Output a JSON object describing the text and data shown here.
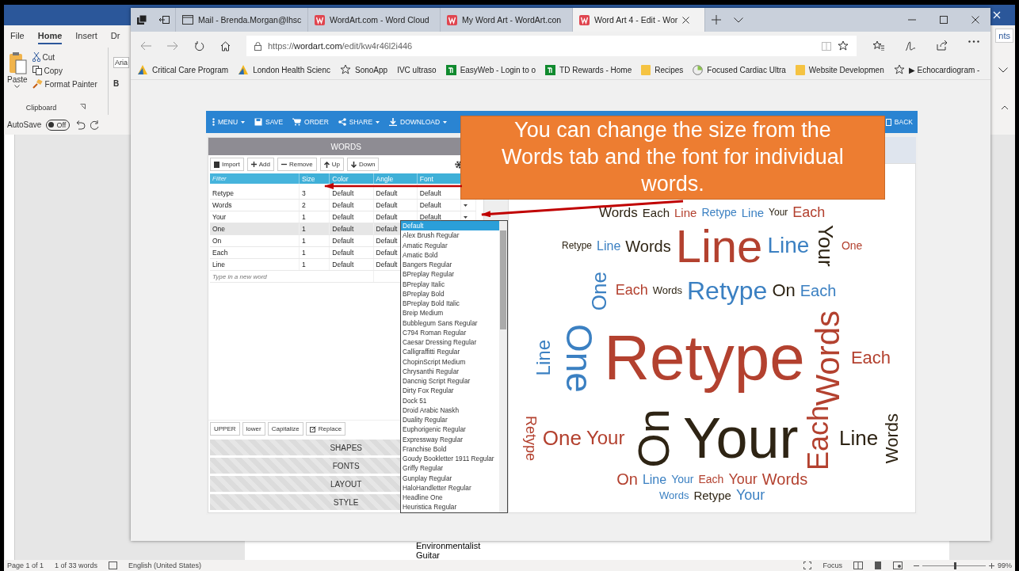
{
  "word": {
    "ribbon_tabs": [
      {
        "label": "File",
        "selected": false
      },
      {
        "label": "Home",
        "selected": true
      },
      {
        "label": "Insert",
        "selected": false
      },
      {
        "label": "Dr",
        "selected": false
      }
    ],
    "clipboard": {
      "paste": "Paste",
      "cut": "Cut",
      "copy": "Copy",
      "format_painter": "Format Painter",
      "group_label": "Clipboard"
    },
    "font_box": "Aria",
    "bold": "B",
    "comments": "nts",
    "autosave": {
      "label": "AutoSave",
      "value": "Off",
      "on": false
    },
    "document_lines": [
      "Environmentalist",
      "Guitar"
    ],
    "status_bar": {
      "page": "Page 1 of 1",
      "words": "1 of 33 words",
      "language": "English (United States)",
      "focus": "Focus",
      "zoom": "99%",
      "level": 0.5
    }
  },
  "browser": {
    "tabs": [
      {
        "title": "Mail - Brenda.Morgan@lhsc",
        "kind": "mail",
        "selected": false
      },
      {
        "title": "WordArt.com - Word Cloud",
        "kind": "wordart",
        "selected": false
      },
      {
        "title": "My Word Art - WordArt.con",
        "kind": "wordart",
        "selected": false
      },
      {
        "title": "Word Art 4 - Edit - Wor",
        "kind": "wordart",
        "selected": true
      }
    ],
    "url": {
      "scheme": "https://",
      "host": "wordart.com",
      "path": "/edit/kw4r46l2i446"
    },
    "favorites": [
      {
        "label": "Critical Care Program",
        "kind": "logo"
      },
      {
        "label": "London Health Scienc",
        "kind": "logo"
      },
      {
        "label": "SonoApp",
        "kind": "star"
      },
      {
        "label": "IVC ultraso",
        "kind": "none"
      },
      {
        "label": "EasyWeb - Login to o",
        "kind": "td"
      },
      {
        "label": "TD Rewards - Home",
        "kind": "td"
      },
      {
        "label": "Recipes",
        "kind": "folder"
      },
      {
        "label": "Focused Cardiac Ultra",
        "kind": "globe"
      },
      {
        "label": "Website Developmen",
        "kind": "folder"
      },
      {
        "label": "▶ Echocardiogram -",
        "kind": "star"
      }
    ]
  },
  "wordart": {
    "toolbar": [
      {
        "label": "MENU",
        "kind": "menu",
        "caret": true
      },
      {
        "label": "SAVE",
        "kind": "save",
        "caret": false
      },
      {
        "label": "ORDER",
        "kind": "cart",
        "caret": false
      },
      {
        "label": "SHARE",
        "kind": "share",
        "caret": true
      },
      {
        "label": "DOWNLOAD",
        "kind": "download",
        "caret": true
      }
    ],
    "back": "BACK",
    "panel_title": "WORDS",
    "word_buttons": [
      {
        "label": "Import",
        "kind": "import"
      },
      {
        "label": "Add",
        "kind": "add"
      },
      {
        "label": "Remove",
        "kind": "remove"
      },
      {
        "label": "Up",
        "kind": "up"
      },
      {
        "label": "Down",
        "kind": "down"
      }
    ],
    "filter_placeholder": "Filter",
    "columns": [
      "Size",
      "Color",
      "Angle",
      "Font"
    ],
    "rows": [
      {
        "word": "Retype",
        "size": "3",
        "color_value": "Default",
        "angle": "Default",
        "font": "Default",
        "selected": false
      },
      {
        "word": "Words",
        "size": "2",
        "color_value": "Default",
        "angle": "Default",
        "font": "Default",
        "selected": false
      },
      {
        "word": "Your",
        "size": "1",
        "color_value": "Default",
        "angle": "Default",
        "font": "Default",
        "selected": false
      },
      {
        "word": "One",
        "size": "1",
        "color_value": "Default",
        "angle": "Default",
        "selected": true
      },
      {
        "word": "On",
        "size": "1",
        "color_value": "Default",
        "angle": "Default",
        "selected": false
      },
      {
        "word": "Each",
        "size": "1",
        "color_value": "Default",
        "angle": "Default",
        "selected": false
      },
      {
        "word": "Line",
        "size": "1",
        "color_value": "Default",
        "angle": "Default",
        "selected": false
      }
    ],
    "new_word_placeholder": "Type in a new word",
    "case_buttons": [
      {
        "label": "UPPER",
        "kind": "text"
      },
      {
        "label": "lower",
        "kind": "text"
      },
      {
        "label": "Capitalize",
        "kind": "text"
      },
      {
        "label": "Replace",
        "kind": "edit"
      }
    ],
    "sections": [
      "SHAPES",
      "FONTS",
      "LAYOUT",
      "STYLE"
    ],
    "font_list": [
      {
        "label": "Default",
        "selected": true
      },
      {
        "label": "Alex Brush Regular",
        "selected": false
      },
      {
        "label": "Amatic Regular",
        "selected": false
      },
      {
        "label": "Amatic Bold",
        "selected": false
      },
      {
        "label": "Bangers Regular",
        "selected": false
      },
      {
        "label": "BPreplay Regular",
        "selected": false
      },
      {
        "label": "BPreplay Italic",
        "selected": false
      },
      {
        "label": "BPreplay Bold",
        "selected": false
      },
      {
        "label": "BPreplay Bold Italic",
        "selected": false
      },
      {
        "label": "Breip Medium",
        "selected": false
      },
      {
        "label": "Bubblegum Sans Regular",
        "selected": false
      },
      {
        "label": "C794 Roman Regular",
        "selected": false
      },
      {
        "label": "Caesar Dressing Regular",
        "selected": false
      },
      {
        "label": "Calligraffitti Regular",
        "selected": false
      },
      {
        "label": "ChopinScript Medium",
        "selected": false
      },
      {
        "label": "Chrysanthi Regular",
        "selected": false
      },
      {
        "label": "Dancnig Script Regular",
        "selected": false
      },
      {
        "label": "Dirty Fox Regular",
        "selected": false
      },
      {
        "label": "Dock 51",
        "selected": false
      },
      {
        "label": "Droid Arabic Naskh",
        "selected": false
      },
      {
        "label": "Duality Regular",
        "selected": false
      },
      {
        "label": "Euphorigenic Regular",
        "selected": false
      },
      {
        "label": "Expressway Regular",
        "selected": false
      },
      {
        "label": "Franchise Bold",
        "selected": false
      },
      {
        "label": "Goudy Bookletter 1911 Regular",
        "selected": false
      },
      {
        "label": "Griffy Regular",
        "selected": false
      },
      {
        "label": "Gunplay Regular",
        "selected": false
      },
      {
        "label": "HaloHandletter Regular",
        "selected": false
      },
      {
        "label": "Headline One",
        "selected": false
      },
      {
        "label": "Heuristica Regular",
        "selected": false
      }
    ],
    "cloud_words": [
      {
        "text": "Words",
        "color": "#2e2414"
      },
      {
        "text": "Each",
        "color": "#2e2414"
      },
      {
        "text": "Line",
        "color": "#b3412f"
      },
      {
        "text": "Retype",
        "color": "#3b80c2"
      },
      {
        "text": "Line",
        "color": "#3b80c2"
      },
      {
        "text": "Your",
        "color": "#2e2414"
      },
      {
        "text": "Each",
        "color": "#b3412f"
      },
      {
        "text": "Retype",
        "color": "#2e2414"
      },
      {
        "text": "Line",
        "color": "#3b80c2"
      },
      {
        "text": "Words",
        "color": "#2e2414"
      },
      {
        "text": "Line",
        "color": "#b3412f"
      },
      {
        "text": "Line",
        "color": "#3b80c2"
      },
      {
        "text": "Your",
        "color": "#2e2414"
      },
      {
        "text": "One",
        "color": "#b3412f"
      },
      {
        "text": "One",
        "color": "#3b80c2"
      },
      {
        "text": "Each",
        "color": "#b3412f"
      },
      {
        "text": "Words",
        "color": "#2e2414"
      },
      {
        "text": "Retype",
        "color": "#3b80c2"
      },
      {
        "text": "On",
        "color": "#2e2414"
      },
      {
        "text": "Each",
        "color": "#3b80c2"
      },
      {
        "text": "Line",
        "color": "#3b80c2"
      },
      {
        "text": "One",
        "color": "#3b80c2"
      },
      {
        "text": "Retype",
        "color": "#b3412f"
      },
      {
        "text": "Words",
        "color": "#b3412f"
      },
      {
        "text": "Each",
        "color": "#b3412f"
      },
      {
        "text": "Retype",
        "color": "#b3412f"
      },
      {
        "text": "One",
        "color": "#b3412f"
      },
      {
        "text": "Your",
        "color": "#b3412f"
      },
      {
        "text": "On",
        "color": "#2e2414"
      },
      {
        "text": "Your",
        "color": "#2e2414"
      },
      {
        "text": "Each",
        "color": "#b3412f"
      },
      {
        "text": "Line",
        "color": "#2e2414"
      },
      {
        "text": "Words",
        "color": "#2e2414"
      },
      {
        "text": "On",
        "color": "#b3412f"
      },
      {
        "text": "Line",
        "color": "#3b80c2"
      },
      {
        "text": "Your",
        "color": "#3b80c2"
      },
      {
        "text": "Each",
        "color": "#b3412f"
      },
      {
        "text": "Your",
        "color": "#b3412f"
      },
      {
        "text": "Words",
        "color": "#b3412f"
      },
      {
        "text": "Words",
        "color": "#3b80c2"
      },
      {
        "text": "Retype",
        "color": "#2e2414"
      },
      {
        "text": "Your",
        "color": "#3b80c2"
      }
    ]
  },
  "callout": {
    "text": "You can change the size from the Words tab and the font for individual words."
  }
}
